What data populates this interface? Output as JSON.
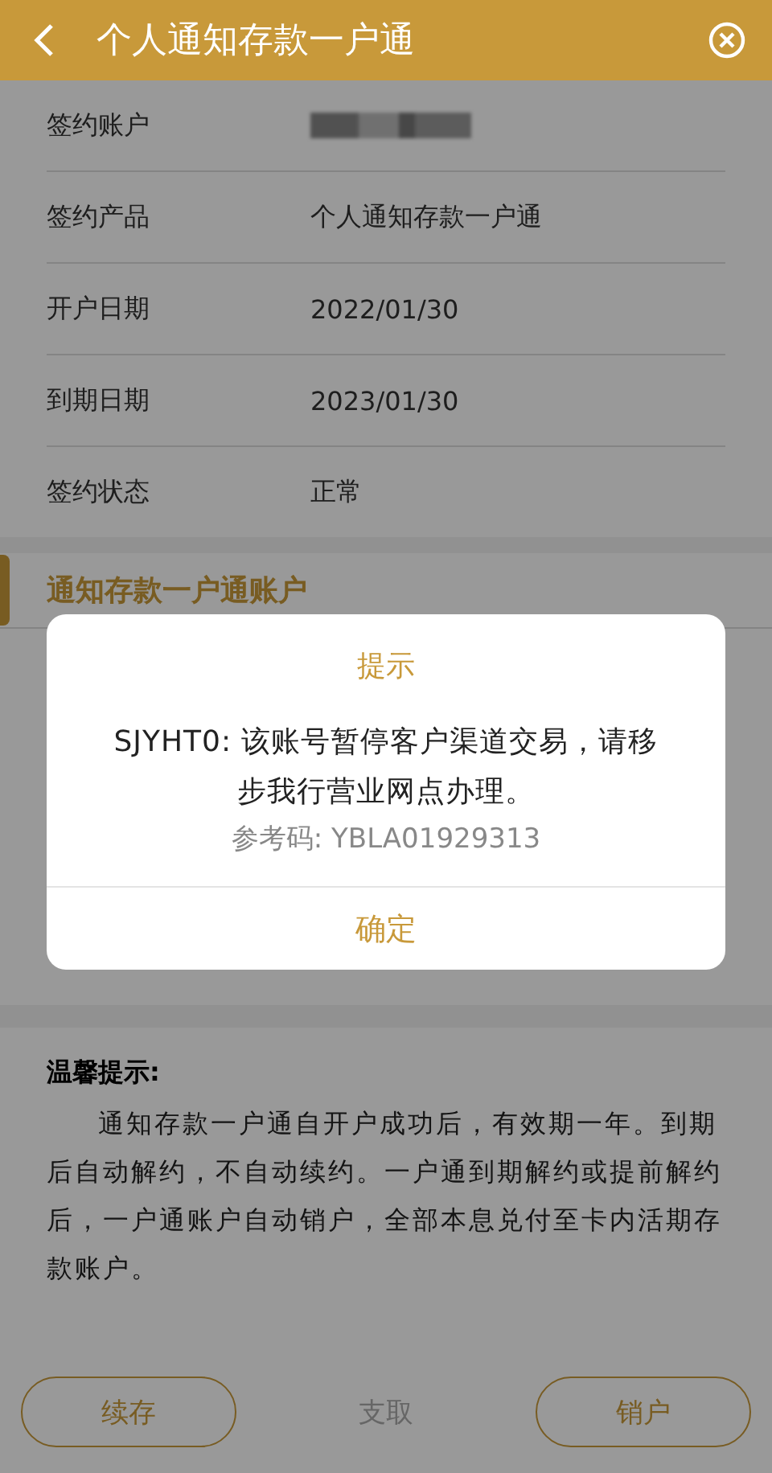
{
  "header": {
    "title": "个人通知存款一户通"
  },
  "details": [
    {
      "label": "签约账户",
      "kind": "redacted"
    },
    {
      "label": "签约产品",
      "kind": "text",
      "value": "个人通知存款一户通"
    },
    {
      "label": "开户日期",
      "kind": "text",
      "value": "2022/01/30"
    },
    {
      "label": "到期日期",
      "kind": "text",
      "value": "2023/01/30"
    },
    {
      "label": "签约状态",
      "kind": "text",
      "value": "正常"
    }
  ],
  "section": {
    "title": "通知存款一户通账户"
  },
  "tips": {
    "title": "温馨提示:",
    "body": "通知存款一户通自开户成功后，有效期一年。到期后自动解约，不自动续约。一户通到期解约或提前解约后，一户通账户自动销户，全部本息兑付至卡内活期存款账户。"
  },
  "buttons": [
    {
      "label": "续存",
      "disabled": false
    },
    {
      "label": "支取",
      "disabled": true
    },
    {
      "label": "销户",
      "disabled": false
    }
  ],
  "dialog": {
    "title": "提示",
    "message": "SJYHT0: 该账号暂停客户渠道交易，请移步我行营业网点办理。",
    "reference": "参考码:  YBLA01929313",
    "button": "确定"
  }
}
